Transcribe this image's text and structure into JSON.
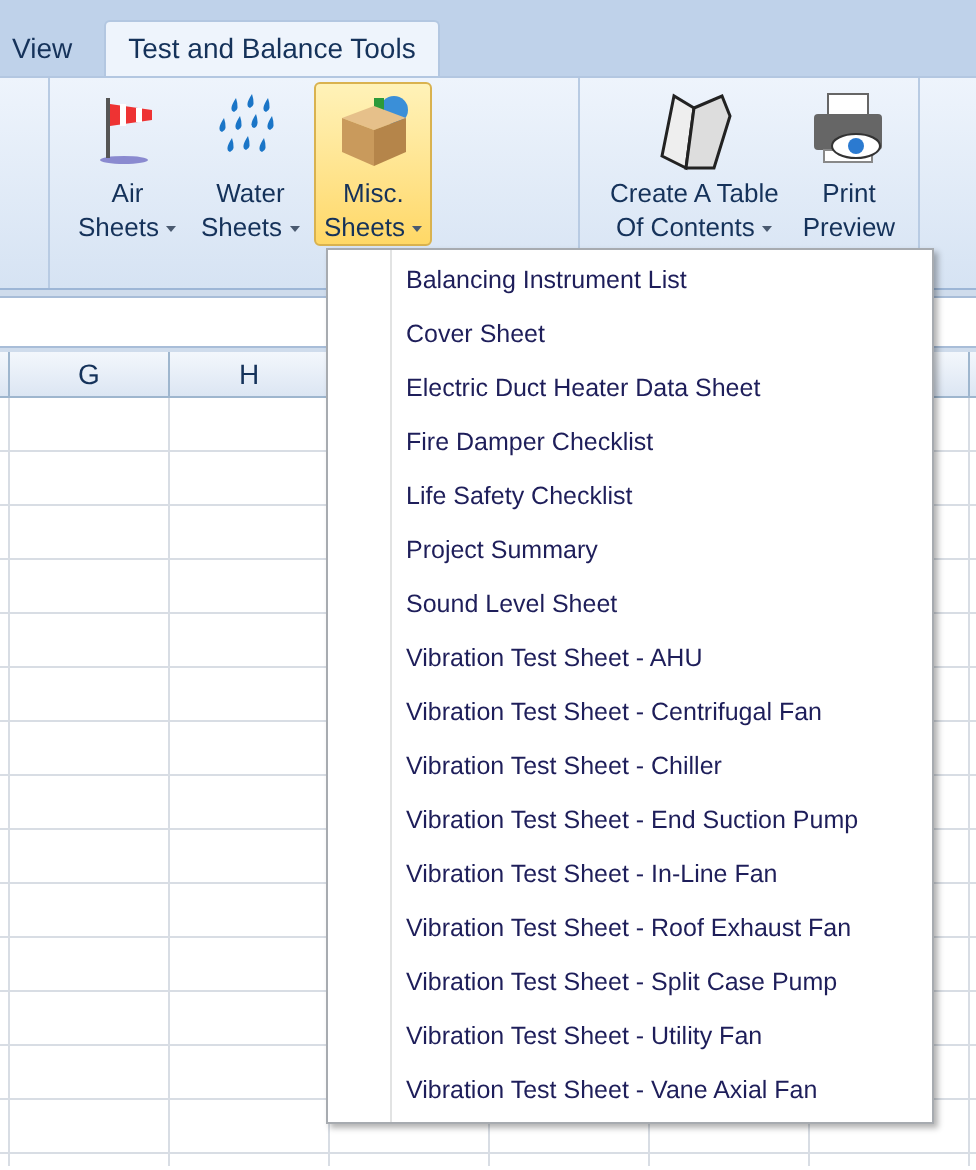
{
  "tabs": [
    {
      "label": "View",
      "selected": false
    },
    {
      "label": "Test and Balance Tools",
      "selected": true
    }
  ],
  "ribbon": {
    "groups": [
      {
        "buttons": [
          {
            "kind": "windsock",
            "lines": [
              "Air",
              "Sheets"
            ],
            "dropdown": true,
            "highlighted": false
          },
          {
            "kind": "drops",
            "lines": [
              "Water",
              "Sheets"
            ],
            "dropdown": true,
            "highlighted": false
          },
          {
            "kind": "box",
            "lines": [
              "Misc.",
              "Sheets"
            ],
            "dropdown": true,
            "highlighted": true
          }
        ]
      },
      {
        "buttons": [
          {
            "kind": "book",
            "lines": [
              "Create A Table",
              "Of Contents"
            ],
            "dropdown": true,
            "highlighted": false
          },
          {
            "kind": "printer",
            "lines": [
              "Print",
              "Preview"
            ],
            "dropdown": false,
            "highlighted": false
          }
        ]
      }
    ]
  },
  "sheet": {
    "columns": [
      "G",
      "H"
    ]
  },
  "menu": {
    "items": [
      "Balancing Instrument List",
      "Cover Sheet",
      "Electric Duct Heater Data Sheet",
      "Fire Damper Checklist",
      "Life Safety Checklist",
      "Project Summary",
      "Sound Level Sheet",
      "Vibration Test Sheet - AHU",
      "Vibration Test Sheet - Centrifugal Fan",
      "Vibration Test Sheet - Chiller",
      "Vibration Test Sheet - End Suction Pump",
      "Vibration Test Sheet - In-Line Fan",
      "Vibration Test Sheet - Roof Exhaust Fan",
      "Vibration Test Sheet - Split Case Pump",
      "Vibration Test Sheet - Utility Fan",
      "Vibration Test Sheet - Vane Axial Fan"
    ]
  }
}
